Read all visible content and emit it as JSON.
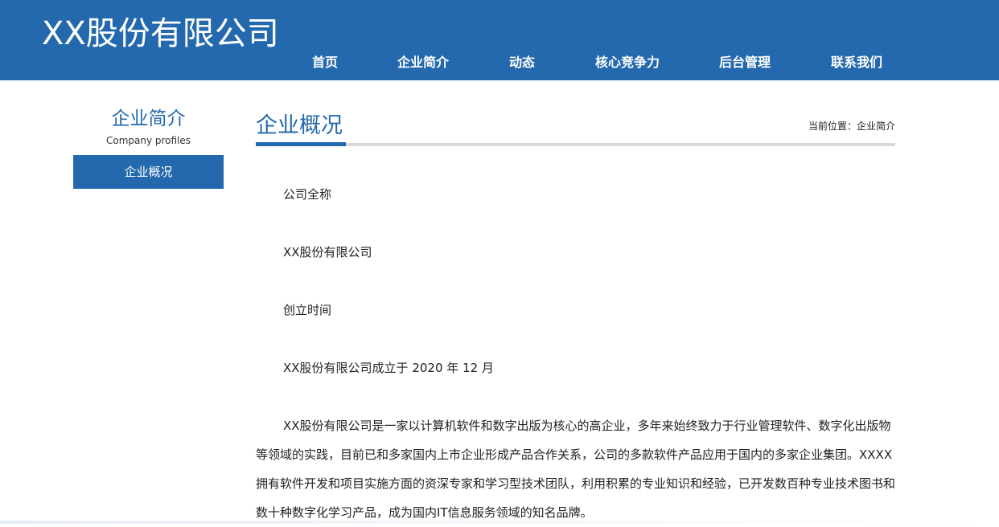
{
  "header": {
    "logo": "XX股份有限公司",
    "nav": [
      "首页",
      "企业简介",
      "动态",
      "核心竞争力",
      "后台管理",
      "联系我们"
    ]
  },
  "sidebar": {
    "title": "企业简介",
    "subtitle": "Company profiles",
    "active_item": "企业概况"
  },
  "content": {
    "title": "企业概况",
    "breadcrumb": "当前位置：企业简介",
    "paragraphs": [
      "公司全称",
      "XX股份有限公司",
      "创立时间",
      "XX股份有限公司成立于 2020 年 12 月",
      "XX股份有限公司是一家以计算机软件和数字出版为核心的高企业，多年来始终致力于行业管理软件、数字化出版物等领域的实践，目前已和多家国内上市企业形成产品合作关系，公司的多款软件产品应用于国内的多家企业集团。XXXX拥有软件开发和项目实施方面的资深专家和学习型技术团队，利用积累的专业知识和经验，已开发数百种专业技术图书和数十种数字化学习产品，成为国内IT信息服务领域的知名品牌。"
    ]
  },
  "colors": {
    "brand_blue": "#2469ad",
    "rule_gray": "#d9d9d9"
  }
}
